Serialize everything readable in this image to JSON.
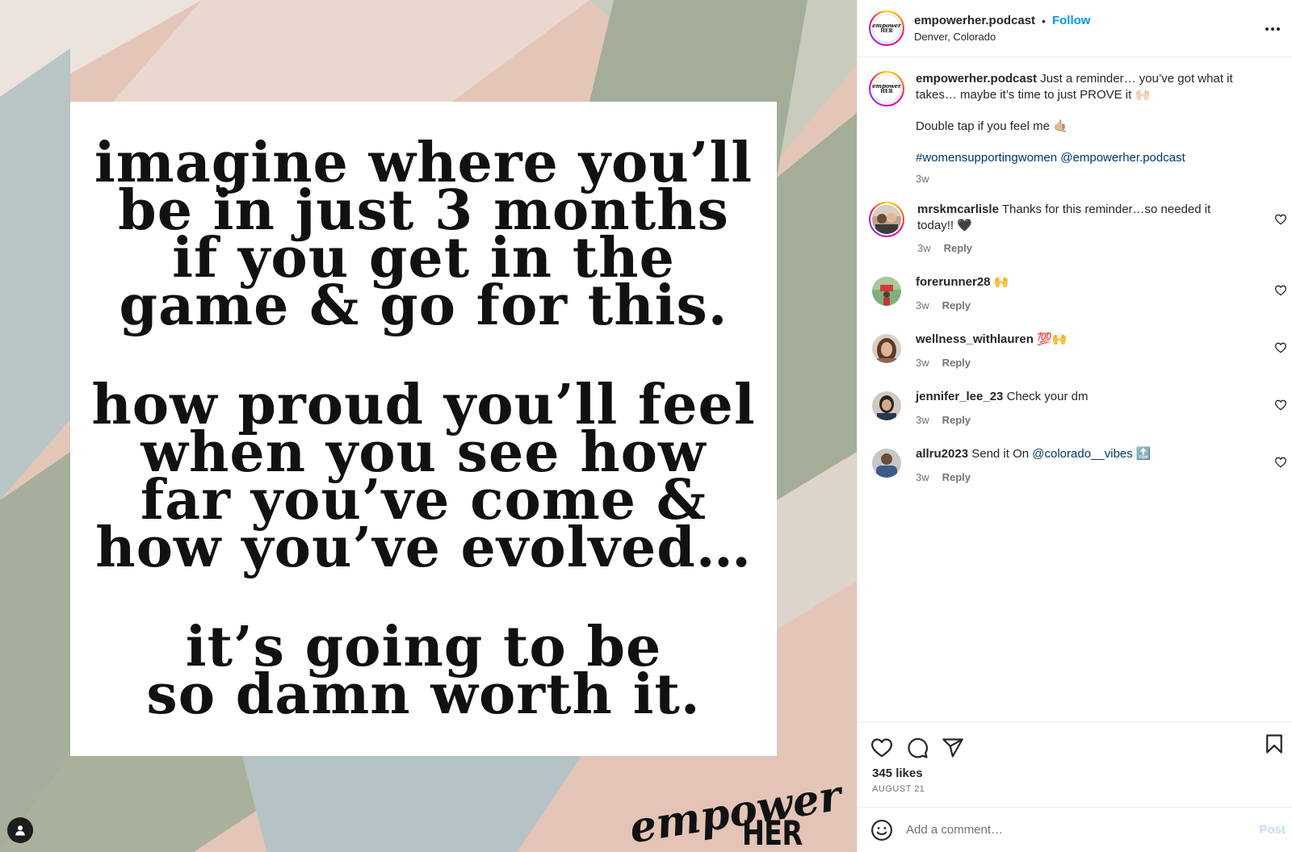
{
  "media": {
    "quote_stanzas": [
      [
        "imagine where you’ll",
        "be in just 3 months",
        "if you get in the",
        "game & go for this."
      ],
      [
        "how proud you’ll feel",
        "when you see how",
        "far you’ve come &",
        "how you’ve evolved…"
      ],
      [
        "it’s going to be",
        "so damn worth it."
      ]
    ],
    "brand_line1": "empower",
    "brand_line2": "HER",
    "user_tag_icon": "person-icon"
  },
  "header": {
    "username": "empowerher.podcast",
    "separator": "•",
    "follow_label": "Follow",
    "location": "Denver, Colorado",
    "avatar_text_a": "empower",
    "avatar_text_b": "HER",
    "more_icon": "more-options-icon"
  },
  "caption": {
    "username": "empowerher.podcast",
    "text_1": "Just a reminder… you’ve got what it takes… maybe it’s time to just PROVE it 🙌🏻",
    "text_2": "Double tap if you feel me 🤙🏼",
    "hashtag": "#womensupportingwomen",
    "mention": "@empowerher.podcast",
    "time": "3w"
  },
  "comments": [
    {
      "username": "mrskmcarlisle",
      "text": "Thanks for this reminder…so needed it today!! 🖤",
      "time": "3w",
      "reply": "Reply",
      "has_story": true
    },
    {
      "username": "forerunner28",
      "text": "🙌",
      "time": "3w",
      "reply": "Reply",
      "has_story": false
    },
    {
      "username": "wellness_withlauren",
      "text": "💯🙌",
      "time": "3w",
      "reply": "Reply",
      "has_story": false
    },
    {
      "username": "jennifer_lee_23",
      "text": "Check your dm",
      "time": "3w",
      "reply": "Reply",
      "has_story": false
    },
    {
      "username": "allru2023",
      "text": "Send it On",
      "mention": "@colorado__vibes",
      "emoji": "🔝",
      "time": "3w",
      "reply": "Reply",
      "has_story": false
    }
  ],
  "actions": {
    "like_icon": "heart-icon",
    "comment_icon": "comment-icon",
    "share_icon": "share-icon",
    "save_icon": "bookmark-icon",
    "likes": "345 likes",
    "date": "AUGUST 21"
  },
  "add_comment": {
    "placeholder": "Add a comment…",
    "post_label": "Post",
    "emoji_icon": "emoji-icon"
  },
  "colors": {
    "accent": "#0095f6",
    "link": "#00376b",
    "muted": "#737373",
    "post_disabled": "#c0dffd",
    "bg_peach": "#e4c6b9",
    "bg_sage": "#a6ae9a",
    "bg_blue": "#b7c4c6",
    "bg_cream": "#ebe3dc"
  }
}
